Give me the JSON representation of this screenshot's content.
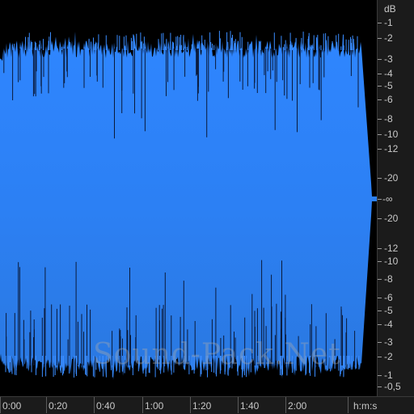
{
  "colors": {
    "background": "#000000",
    "waveform_top": "#2f84ff",
    "waveform_bottom": "#2a7ae0",
    "ruler_bg": "#1b1b1b",
    "ruler_text": "#c8c8c8"
  },
  "db_scale": {
    "unit": "dB",
    "labels": [
      "-1",
      "-2",
      "-3",
      "-4",
      "-5",
      "-6",
      "-8",
      "-10",
      "-12",
      "-20",
      "-∞",
      "-20",
      "-12",
      "-10",
      "-8",
      "-6",
      "-5",
      "-4",
      "-3",
      "-2",
      "-1",
      "-0,5"
    ]
  },
  "time_ruler": {
    "unit_label": "h:m:s",
    "labels": [
      "0:00",
      "0:20",
      "0:40",
      "1:00",
      "1:20",
      "1:40",
      "2:00"
    ]
  },
  "waveform": {
    "channel": "mono",
    "peak_level_db": "-2",
    "tail_fadeout": true
  },
  "watermark": "Sound-Pack.Net"
}
